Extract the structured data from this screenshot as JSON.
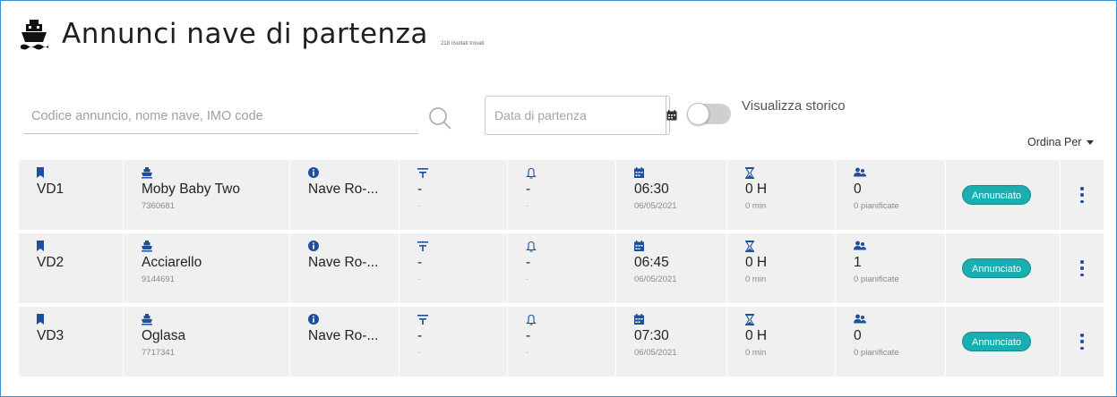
{
  "header": {
    "title": "Annunci nave di partenza",
    "results_text": "218 risultati trovati"
  },
  "search": {
    "placeholder": "Codice annuncio, nome nave, IMO code",
    "value": ""
  },
  "date_filter": {
    "placeholder": "Data di partenza",
    "value": ""
  },
  "history_toggle": {
    "label": "Visualizza storico",
    "on": false
  },
  "sort": {
    "label": "Ordina Per"
  },
  "colors": {
    "accent": "#1d4f9c",
    "badge": "#1aaeb0",
    "row_bg": "#f0f0f0",
    "frame": "#3a8fd6"
  },
  "icons": {
    "title": "ship-icon",
    "col1": "bookmark-icon",
    "col2": "ship-icon",
    "col3": "info-icon",
    "col4": "filter-icon",
    "col5": "bell-icon",
    "col6": "calendar-icon",
    "col7": "hourglass-icon",
    "col8": "users-icon",
    "search": "search-icon",
    "date": "calendar-icon"
  },
  "rows": [
    {
      "code": "VD1",
      "ship_name": "Moby Baby Two",
      "imo": "7360681",
      "type": "Nave Ro-...",
      "filter_value": "-",
      "filter_sub": "-",
      "bell_value": "-",
      "bell_sub": "-",
      "time": "06:30",
      "date": "06/05/2021",
      "duration_h": "0 H",
      "duration_min": "0 min",
      "count": "0",
      "count_sub": "0 pianificate",
      "status": "Annunciato"
    },
    {
      "code": "VD2",
      "ship_name": "Acciarello",
      "imo": "9144691",
      "type": "Nave Ro-...",
      "filter_value": "-",
      "filter_sub": "-",
      "bell_value": "-",
      "bell_sub": "-",
      "time": "06:45",
      "date": "06/05/2021",
      "duration_h": "0 H",
      "duration_min": "0 min",
      "count": "1",
      "count_sub": "0 pianificate",
      "status": "Annunciato"
    },
    {
      "code": "VD3",
      "ship_name": "Oglasa",
      "imo": "7717341",
      "type": "Nave Ro-...",
      "filter_value": "-",
      "filter_sub": "-",
      "bell_value": "-",
      "bell_sub": "-",
      "time": "07:30",
      "date": "06/05/2021",
      "duration_h": "0 H",
      "duration_min": "0 min",
      "count": "0",
      "count_sub": "0 pianificate",
      "status": "Annunciato"
    }
  ]
}
